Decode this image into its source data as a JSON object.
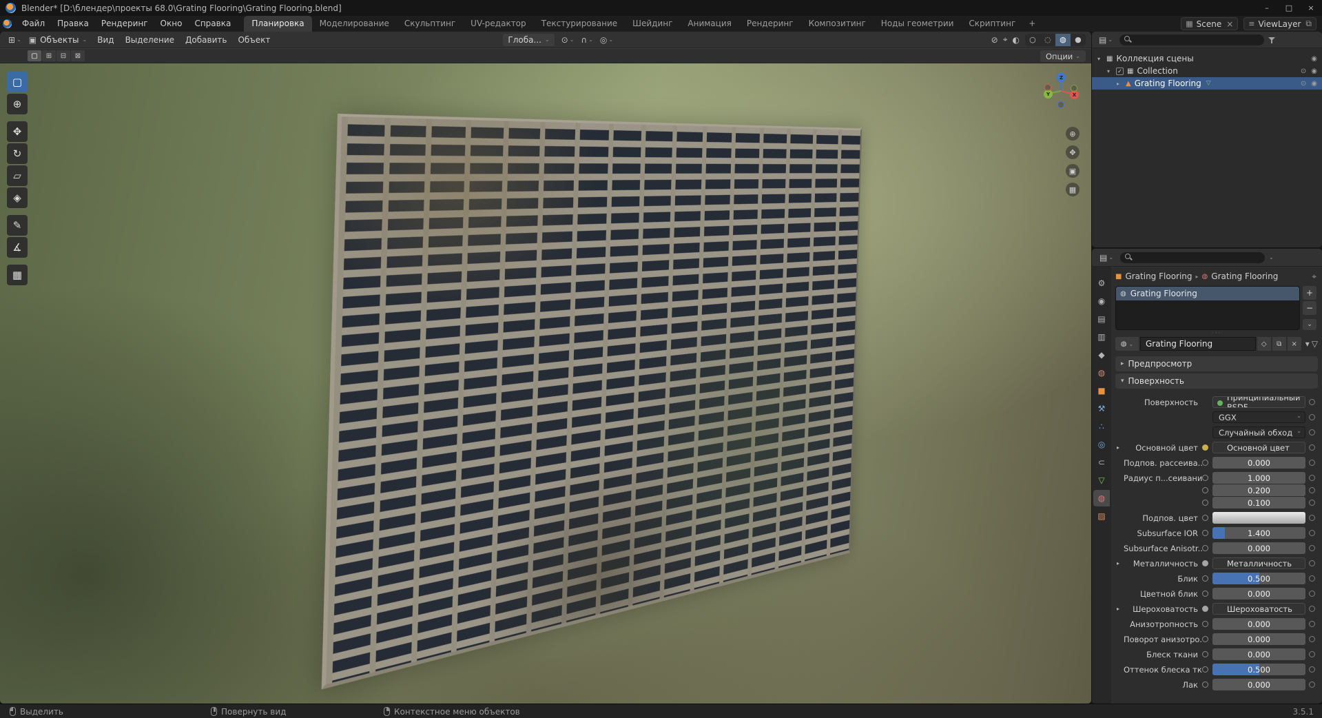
{
  "colors": {
    "accent": "#4772b3",
    "selection": "#3a5a88",
    "active_tool": "#3b6ba5",
    "object_orange": "#e8913c",
    "data_green": "#7fc95b",
    "material_pink": "#d9777a"
  },
  "titlebar": {
    "title": "Blender* [D:\\блендер\\проекты 68.0\\Grating Flooring\\Grating Flooring.blend]",
    "minimize": "–",
    "maximize": "□",
    "close": "×"
  },
  "topbar": {
    "menus": [
      "Файл",
      "Правка",
      "Рендеринг",
      "Окно",
      "Справка"
    ],
    "workspaces": [
      "Планировка",
      "Моделирование",
      "Скульптинг",
      "UV-редактор",
      "Текстурирование",
      "Шейдинг",
      "Анимация",
      "Рендеринг",
      "Композитинг",
      "Ноды геометрии",
      "Скриптинг"
    ],
    "active_workspace": "Планировка",
    "add_workspace_label": "+",
    "scene_selector": {
      "icon_glyph": "▦",
      "label": "Scene",
      "unlink_glyph": "×"
    },
    "viewlayer_selector": {
      "icon_glyph": "≡",
      "label": "ViewLayer",
      "copy_glyph": "⧉"
    }
  },
  "viewport": {
    "header": {
      "editor_icon_glyph": "⊞",
      "mode_icon_glyph": "▣",
      "mode_label": "Объекты",
      "menus": [
        "Вид",
        "Выделение",
        "Добавить",
        "Объект"
      ],
      "orientation_label": "Глоба...",
      "pivot_glyph": "⊙",
      "snap_glyph": "∩",
      "proportional_glyph": "◎",
      "overlay_glyphs": [
        "⊘",
        "⌖",
        "◐"
      ],
      "shading": [
        {
          "name": "wireframe-shading-button",
          "glyph": "○",
          "active": false
        },
        {
          "name": "solid-shading-button",
          "glyph": "◌",
          "active": false
        },
        {
          "name": "material-preview-shading-button",
          "glyph": "◍",
          "active": true
        },
        {
          "name": "rendered-shading-button",
          "glyph": "●",
          "active": false
        }
      ],
      "dropdown_arrow": "⌄"
    },
    "tool_settings": {
      "select_mode_glyphs": [
        "▢",
        "⊞",
        "⊟",
        "⊠"
      ],
      "options_label": "Опции"
    },
    "tools": [
      {
        "name": "select-box-tool",
        "glyph": "▢",
        "active": true
      },
      {
        "name": "cursor-tool",
        "glyph": "⊕",
        "gap_after": true
      },
      {
        "name": "move-tool",
        "glyph": "✥"
      },
      {
        "name": "rotate-tool",
        "glyph": "↻"
      },
      {
        "name": "scale-tool",
        "glyph": "▱"
      },
      {
        "name": "transform-tool",
        "glyph": "◈",
        "gap_after": true
      },
      {
        "name": "annotate-tool",
        "glyph": "✎"
      },
      {
        "name": "measure-tool",
        "glyph": "∡",
        "gap_after": true
      },
      {
        "name": "add-cube-tool",
        "glyph": "▦"
      }
    ],
    "gizmo": {
      "x": "X",
      "y": "Y",
      "z": "Z"
    },
    "nav_buttons": [
      {
        "name": "zoom-button",
        "glyph": "⊕"
      },
      {
        "name": "pan-button",
        "glyph": "✥"
      },
      {
        "name": "camera-view-button",
        "glyph": "▣"
      },
      {
        "name": "toggle-grid-button",
        "glyph": "▦"
      }
    ]
  },
  "outliner": {
    "rows": [
      {
        "label": "Коллекция сцены",
        "level": 0,
        "expander": "▾",
        "icon": "collection-icon",
        "icon_glyph": "▦",
        "eye": false,
        "camera": true,
        "checkbox": false,
        "selected": false
      },
      {
        "label": "Collection",
        "level": 1,
        "expander": "▾",
        "icon": "collection-icon",
        "icon_glyph": "▦",
        "eye": true,
        "camera": true,
        "checkbox": true,
        "selected": false
      },
      {
        "label": "Grating Flooring",
        "level": 2,
        "expander": "▸",
        "icon": "mesh-object-icon",
        "icon_glyph": "▲",
        "eye": true,
        "camera": true,
        "checkbox": false,
        "selected": true,
        "extra_icon_glyph": "▽"
      }
    ]
  },
  "properties": {
    "tabs": [
      {
        "name": "tool-tab",
        "glyph": "⚙",
        "color": "#b5b5b5",
        "active": false
      },
      {
        "name": "render-tab",
        "glyph": "◉",
        "color": "#b5b5b5",
        "active": false
      },
      {
        "name": "output-tab",
        "glyph": "▤",
        "color": "#b5b5b5",
        "active": false
      },
      {
        "name": "view-layer-tab",
        "glyph": "▥",
        "color": "#b5b5b5",
        "active": false
      },
      {
        "name": "scene-tab",
        "glyph": "◆",
        "color": "#b5b5b5",
        "active": false
      },
      {
        "name": "world-tab",
        "glyph": "◍",
        "color": "#cf8a7a",
        "active": false
      },
      {
        "name": "object-tab",
        "glyph": "■",
        "color": "#e8913c",
        "active": false
      },
      {
        "name": "modifiers-tab",
        "glyph": "⚒",
        "color": "#79aede",
        "active": false
      },
      {
        "name": "particles-tab",
        "glyph": "∴",
        "color": "#79aede",
        "active": false
      },
      {
        "name": "physics-tab",
        "glyph": "◎",
        "color": "#79aede",
        "active": false
      },
      {
        "name": "constraints-tab",
        "glyph": "⊂",
        "color": "#b5b5b5",
        "active": false
      },
      {
        "name": "object-data-tab",
        "glyph": "▽",
        "color": "#7fc95b",
        "active": false
      },
      {
        "name": "material-tab",
        "glyph": "◍",
        "color": "#d9777a",
        "active": true
      },
      {
        "name": "texture-tab",
        "glyph": "▨",
        "color": "#d98e5f",
        "active": false
      }
    ],
    "breadcrumb": {
      "object": "Grating Flooring",
      "separator": "▸",
      "material": "Grating Flooring",
      "pin_glyph": "⌖"
    },
    "slots": {
      "items": [
        "Grating Flooring"
      ],
      "add_glyph": "+",
      "remove_glyph": "−",
      "specials_glyph": "⌄",
      "grip": "···"
    },
    "material_block": {
      "browse_glyph": "◍",
      "name": "Grating Flooring",
      "fake_user_glyph": "◇",
      "copy_glyph": "⧉",
      "unlink_glyph": "×",
      "specials_glyph": "▾",
      "nodes_glyph": "▽"
    },
    "panels": {
      "preview_label": "Предпросмотр",
      "surface_label": "Поверхность"
    },
    "surface_rows": [
      {
        "label": "Поверхность",
        "type": "button",
        "value": "Принципиальный BSDF",
        "inner_dot": "#63b35d",
        "socket": false
      },
      {
        "label": "",
        "type": "dropdown",
        "value": "GGX",
        "socket": false
      },
      {
        "label": "",
        "type": "dropdown",
        "value": "Случайный обход",
        "socket": false
      },
      {
        "label": "Основной цвет",
        "type": "button",
        "value": "Основной цвет",
        "expander": true,
        "socket_color": "#c8b14a"
      },
      {
        "label": "Подпов. рассеива...",
        "type": "slider",
        "value": "0.000",
        "fill": 0
      },
      {
        "label": "Радиус п...сеивания",
        "type": "number",
        "value": "1.000"
      },
      {
        "label": "",
        "type": "number",
        "value": "0.200",
        "stacked": true
      },
      {
        "label": "",
        "type": "number",
        "value": "0.100",
        "stacked": true
      },
      {
        "label": "Подпов. цвет",
        "type": "color",
        "value": ""
      },
      {
        "label": "Subsurface IOR",
        "type": "slider",
        "value": "1.400",
        "fill": 13
      },
      {
        "label": "Subsurface Anisotr...",
        "type": "slider",
        "value": "0.000",
        "fill": 0
      },
      {
        "label": "Металличность",
        "type": "button",
        "value": "Металличность",
        "expander": true,
        "socket_color": "#a5a5a5"
      },
      {
        "label": "Блик",
        "type": "slider",
        "value": "0.500",
        "fill": 50
      },
      {
        "label": "Цветной блик",
        "type": "slider",
        "value": "0.000",
        "fill": 0
      },
      {
        "label": "Шероховатость",
        "type": "button",
        "value": "Шероховатость",
        "expander": true,
        "socket_color": "#a5a5a5"
      },
      {
        "label": "Анизотропность",
        "type": "slider",
        "value": "0.000",
        "fill": 0
      },
      {
        "label": "Поворот анизотро...",
        "type": "slider",
        "value": "0.000",
        "fill": 0
      },
      {
        "label": "Блеск ткани",
        "type": "slider",
        "value": "0.000",
        "fill": 0
      },
      {
        "label": "Оттенок блеска тк...",
        "type": "slider",
        "value": "0.500",
        "fill": 50
      },
      {
        "label": "Лак",
        "type": "slider",
        "value": "0.000",
        "fill": 0
      }
    ]
  },
  "statusbar": {
    "items": [
      {
        "icon": "mouse-left-icon",
        "label": "Выделить"
      },
      {
        "icon": "mouse-middle-icon",
        "label": "Повернуть вид"
      },
      {
        "icon": "mouse-right-icon",
        "label": "Контекстное меню объектов"
      }
    ],
    "version": "3.5.1"
  }
}
